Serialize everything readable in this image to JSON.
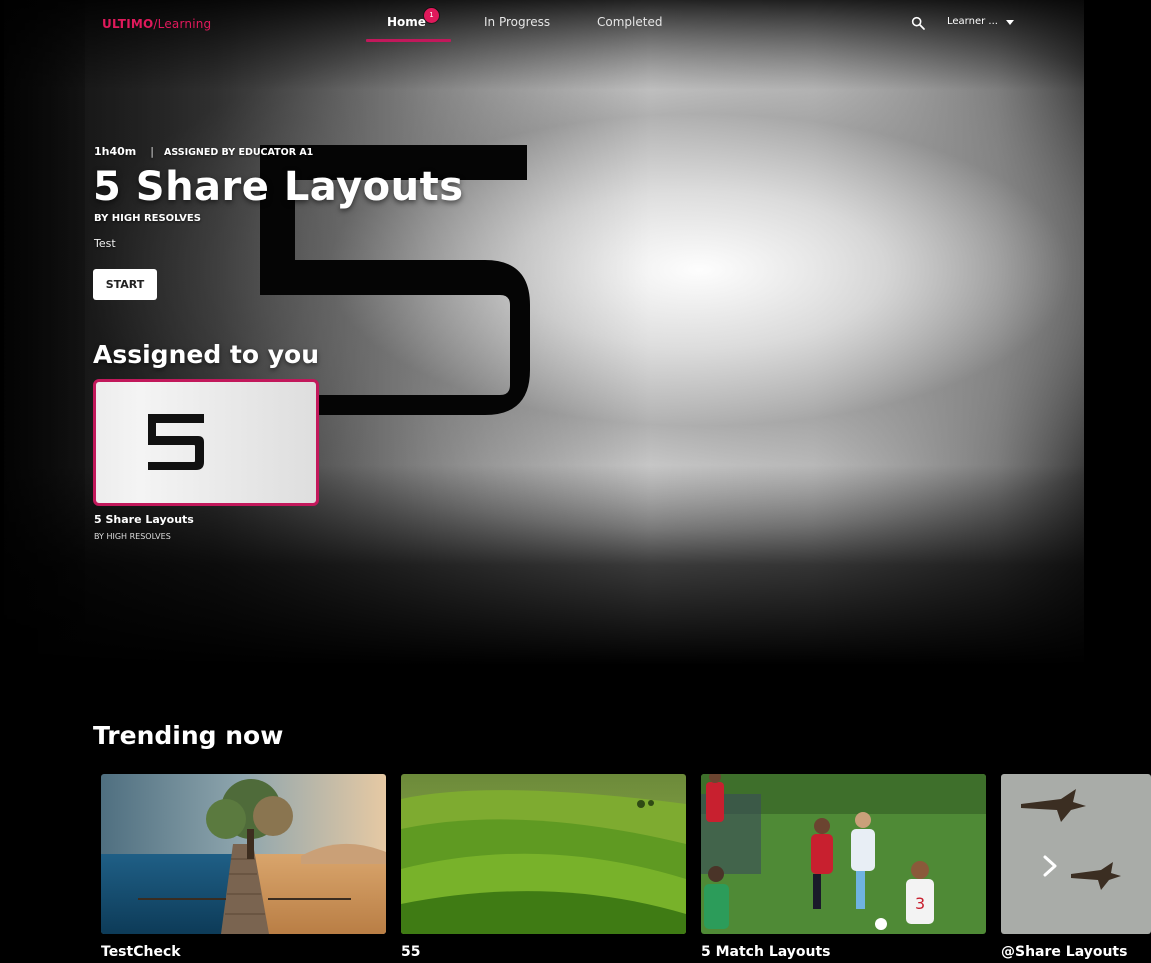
{
  "app": {
    "logo_brand": "ULTIMO",
    "logo_rest": "/Learning"
  },
  "nav": {
    "tabs": [
      {
        "label": "Home",
        "active": true,
        "badge": "1"
      },
      {
        "label": "In Progress",
        "active": false
      },
      {
        "label": "Completed",
        "active": false
      }
    ],
    "user_label": "Learner ..."
  },
  "hero": {
    "duration": "1h40m",
    "separator": "|",
    "assigned_by": "ASSIGNED BY EDUCATOR A1",
    "title": "5 Share Layouts",
    "author": "BY HIGH RESOLVES",
    "description": "Test",
    "start_label": "START",
    "artwork_glyph": "5"
  },
  "assigned": {
    "heading": "Assigned to you",
    "cards": [
      {
        "title": "5 Share Layouts",
        "author": "BY HIGH RESOLVES"
      }
    ]
  },
  "trending": {
    "heading": "Trending now",
    "items": [
      {
        "title": "TestCheck",
        "image": "pier-sea-desert"
      },
      {
        "title": "55",
        "image": "green-hills"
      },
      {
        "title": "5 Match Layouts",
        "image": "soccer-players"
      },
      {
        "title": "@Share Layouts",
        "image": "fighter-jets"
      }
    ]
  },
  "colors": {
    "accent": "#e0195b",
    "underline": "#c2185b",
    "background": "#000000"
  }
}
